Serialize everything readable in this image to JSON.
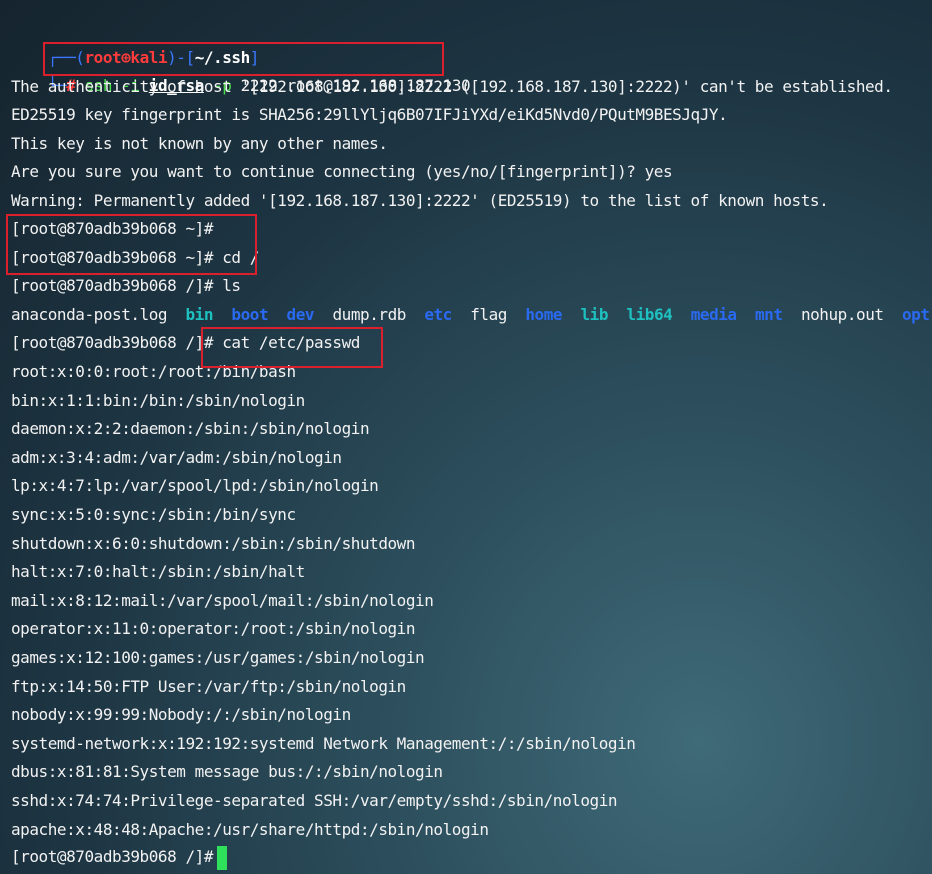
{
  "prompt": {
    "corner_top": "┌──(",
    "user": "root",
    "sep_glyph": "⊕",
    "host": "kali",
    "mid": ")-[",
    "path": "~/.ssh",
    "end": "]",
    "corner_bottom": "└─",
    "hash": "#"
  },
  "command": {
    "cmd": "ssh",
    "flag_i": "-i",
    "key": "id_rsa",
    "flag_p": "-p",
    "port_target": "2222 root@192.168.187.130"
  },
  "ssh_output": [
    "The authenticity of host '[192.168.187.130]:2222 ([192.168.187.130]:2222)' can't be established.",
    "ED25519 key fingerprint is SHA256:29llYljq6B07IFJiYXd/eiKd5Nvd0/PQutM9BESJqJY.",
    "This key is not known by any other names.",
    "Are you sure you want to continue connecting (yes/no/[fingerprint])? yes",
    "Warning: Permanently added '[192.168.187.130]:2222' (ED25519) to the list of known hosts."
  ],
  "remote": {
    "prompt_home": "[root@870adb39b068 ~]#",
    "prompt_home_cd": "[root@870adb39b068 ~]# cd /",
    "prompt_root_ls": "[root@870adb39b068 /]# ls",
    "prompt_root_cat": "[root@870adb39b068 /]# cat /etc/passwd",
    "prompt_final": "[root@870adb39b068 /]# "
  },
  "ls_entries": [
    {
      "name": "anaconda-post.log",
      "type": "file"
    },
    {
      "name": "bin",
      "type": "link"
    },
    {
      "name": "boot",
      "type": "dir"
    },
    {
      "name": "dev",
      "type": "dir"
    },
    {
      "name": "dump.rdb",
      "type": "file"
    },
    {
      "name": "etc",
      "type": "dir"
    },
    {
      "name": "flag",
      "type": "file"
    },
    {
      "name": "home",
      "type": "dir"
    },
    {
      "name": "lib",
      "type": "link"
    },
    {
      "name": "lib64",
      "type": "link"
    },
    {
      "name": "media",
      "type": "dir"
    },
    {
      "name": "mnt",
      "type": "dir"
    },
    {
      "name": "nohup.out",
      "type": "file"
    },
    {
      "name": "opt",
      "type": "dir"
    }
  ],
  "passwd_lines": [
    "root:x:0:0:root:/root:/bin/bash",
    "bin:x:1:1:bin:/bin:/sbin/nologin",
    "daemon:x:2:2:daemon:/sbin:/sbin/nologin",
    "adm:x:3:4:adm:/var/adm:/sbin/nologin",
    "lp:x:4:7:lp:/var/spool/lpd:/sbin/nologin",
    "sync:x:5:0:sync:/sbin:/bin/sync",
    "shutdown:x:6:0:shutdown:/sbin:/sbin/shutdown",
    "halt:x:7:0:halt:/sbin:/sbin/halt",
    "mail:x:8:12:mail:/var/spool/mail:/sbin/nologin",
    "operator:x:11:0:operator:/root:/sbin/nologin",
    "games:x:12:100:games:/usr/games:/sbin/nologin",
    "ftp:x:14:50:FTP User:/var/ftp:/sbin/nologin",
    "nobody:x:99:99:Nobody:/:/sbin/nologin",
    "systemd-network:x:192:192:systemd Network Management:/:/sbin/nologin",
    "dbus:x:81:81:System message bus:/:/sbin/nologin",
    "sshd:x:74:74:Privilege-separated SSH:/var/empty/sshd:/sbin/nologin",
    "apache:x:48:48:Apache:/usr/share/httpd:/sbin/nologin"
  ],
  "colors": {
    "prompt_frame": "#3b78ff",
    "prompt_user": "#ff3b3b",
    "command": "#4cdc4c",
    "link": "#1ec0c0",
    "directory": "#2a6af0",
    "highlight_box": "#d9202c",
    "cursor": "#2fe05a"
  }
}
